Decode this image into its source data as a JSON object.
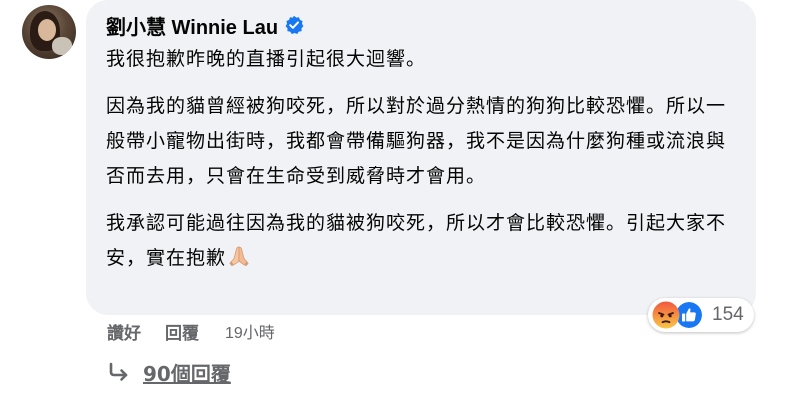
{
  "comment": {
    "author": "劉小慧 Winnie Lau",
    "verified": true,
    "paragraphs": [
      "我很抱歉昨晚的直播引起很大迴響。",
      "因為我的貓曾經被狗咬死，所以對於過分熱情的狗狗比較恐懼。所以一般帶小寵物出街時，我都會帶備驅狗器，我不是因為什麼狗種或流浪與否而去用，只會在生命受到威脅時才會用。",
      "我承認可能過往因為我的貓被狗咬死，所以才會比較恐懼。引起大家不安，實在抱歉"
    ],
    "trailing_emoji": "folded-hands-icon"
  },
  "reactions": {
    "icons": [
      "angry-reaction-icon",
      "like-reaction-icon"
    ],
    "count": "154"
  },
  "actions": {
    "like": "讚好",
    "reply": "回覆",
    "timestamp": "19小時"
  },
  "more_replies": {
    "label": "90個回覆"
  },
  "colors": {
    "bubble": "#f0f2f5",
    "verified": "#1877f2",
    "secondary_text": "#65676b",
    "like_blue": "#1877f2",
    "angry_top": "#f2573f",
    "angry_bottom": "#f9c746"
  }
}
